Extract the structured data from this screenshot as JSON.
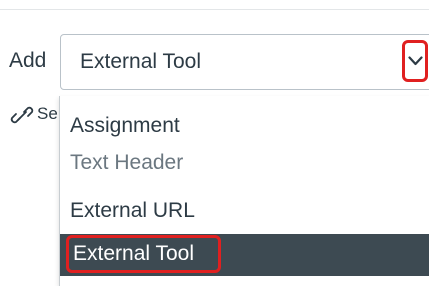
{
  "form": {
    "add_label": "Add",
    "select": {
      "selected_value": "External Tool"
    },
    "behind_text": "Se"
  },
  "dropdown": {
    "options": [
      {
        "label": "Assignment"
      },
      {
        "label": "Text Header"
      },
      {
        "label": "External URL"
      },
      {
        "label": "External Tool",
        "selected": true
      }
    ]
  },
  "colors": {
    "highlight_outline": "#e02020",
    "selected_option_bg": "#3d4a52",
    "text": "#2d3b45"
  },
  "icons": {
    "arrow": "chevron-down-icon",
    "link": "link-icon"
  }
}
